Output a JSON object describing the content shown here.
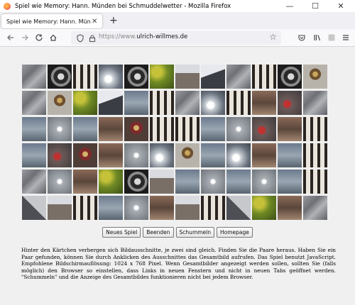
{
  "window": {
    "title": "Spiel wie Memory: Hann. Münden bei Schmuddelwetter - Mozilla Firefox"
  },
  "tab": {
    "title": "Spiel wie Memory: Hann. Münden"
  },
  "urlbar": {
    "prefix": "https://www.",
    "domain": "ulrich-willmes.de"
  },
  "buttons": {
    "new_game": "Neues Spiel",
    "quit": "Beenden",
    "shuffle": "Schummeln",
    "homepage": "Homepage"
  },
  "description": "Hinter den Kärtchen verbergen sich Bildausschnitte, je zwei sind gleich. Finden Sie die Paare heraus. Haben Sie ein Paar gefunden, können Sie durch Anklicken des Ausschnittes das Gesamtbild aufrufen. Das Spiel benutzt JavaScript. Empfohlene Bildschirmauflösung: 1024 x 768 Pixel. Wenn Gesamtbilder angezeigt werden sollen, sollten Sie (falls möglich) den Browser so einstellen, dass Links in neuen Fenstern und nicht in neuen Tabs geöffnet werden. \"Schummeln\" und die Anzeige des Gesamtbildes funktionieren nicht bei jedem Browser.",
  "grid": {
    "tiles": [
      "stone",
      "wheel",
      "halftimber",
      "fountain",
      "wheel",
      "leaves",
      "tower",
      "spire",
      "stone",
      "halftimber",
      "wheel",
      "clock",
      "stone",
      "clock",
      "leaves",
      "spire",
      "water",
      "halftimber",
      "stone",
      "fountain",
      "halftimber",
      "wall",
      "people",
      "stone",
      "water",
      "bird",
      "water",
      "wall",
      "sign",
      "halftimber",
      "halftimber",
      "water",
      "bird",
      "people",
      "wall",
      "halftimber",
      "water",
      "people",
      "sign",
      "wall",
      "bird",
      "fountain",
      "clock",
      "water",
      "fountain",
      "wall",
      "water",
      "halftimber",
      "stone",
      "bird",
      "wall",
      "leaves",
      "wheel",
      "tower",
      "water",
      "bird",
      "water",
      "bird",
      "water",
      "halftimber",
      "roof",
      "tower",
      "halftimber",
      "water",
      "bird",
      "wall",
      "tower",
      "halftimber",
      "roof",
      "leaves",
      "wall",
      "stone"
    ]
  },
  "tile_styles": {
    "stone": "linear-gradient(135deg,#9a9aa0 0%,#6e7076 35%,#b0b2b6 60%,#5e6066 100%)",
    "wheel": "radial-gradient(circle at 55% 50%,#d8d8d8 0 18%,#2a2a2a 19% 40%,#8a8a8a 41% 55%,#1c1c1c 56% 100%)",
    "halftimber": "repeating-linear-gradient(90deg,#2b2420 0 4px,#e9e5dc 4px 10px)",
    "fountain": "radial-gradient(circle at 40% 60%,#ffffff 0 15%,#c7ccd2 25%,#6b7480 60%,#3d434b 100%)",
    "leaves": "radial-gradient(circle at 30% 30%,#c5c23a 0 20%,#6f8a24 45%,#3c5016 100%)",
    "tower": "linear-gradient(#d9dbe0 0 35%,#7a6f66 35% 100%)",
    "spire": "linear-gradient(160deg,#e7e9ee 0 40%,#3a3d44 41% 100%)",
    "clock": "radial-gradient(circle at 50% 40%,#caa65a 0 14%,#6d5030 15% 30%,#b8b3aa 31% 100%)",
    "water": "linear-gradient(#6b7a8d 0%,#9aa6b2 50%,#57636f 100%)",
    "bird": "radial-gradient(circle at 50% 50%,#ffffff 0 10%,#a7adb3 20%,#6c7278 100%)",
    "wall": "linear-gradient(180deg,#8a6a58 0%,#5b463b 50%,#a08570 100%)",
    "people": "radial-gradient(circle at 40% 55%,#c23030 0 14%,#6a5a58 26%,#3f3a3c 100%)",
    "sign": "radial-gradient(circle at 50% 45%,#d4b06a 0 15%,#7d2a2a 16% 35%,#4f3d38 36% 100%)",
    "roof": "linear-gradient(45deg,#4d4f55 0 50%,#c6c8cc 51% 100%)"
  }
}
